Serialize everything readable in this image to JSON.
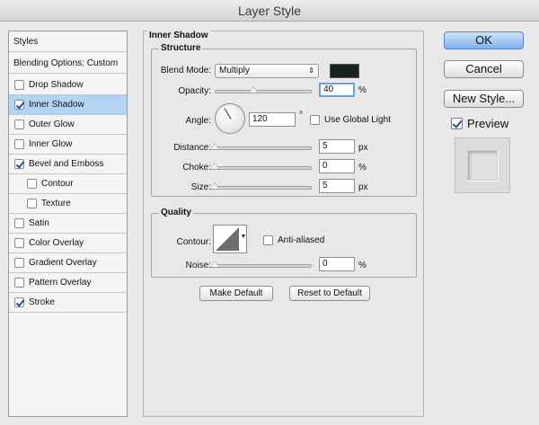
{
  "window": {
    "title": "Layer Style"
  },
  "styles_panel": {
    "header": "Styles",
    "blending_options": "Blending Options: Custom",
    "items": [
      {
        "label": "Drop Shadow",
        "checked": false,
        "selected": false
      },
      {
        "label": "Inner Shadow",
        "checked": true,
        "selected": true
      },
      {
        "label": "Outer Glow",
        "checked": false,
        "selected": false
      },
      {
        "label": "Inner Glow",
        "checked": false,
        "selected": false
      },
      {
        "label": "Bevel and Emboss",
        "checked": true,
        "selected": false
      },
      {
        "label": "Contour",
        "checked": false,
        "selected": false,
        "sub": true
      },
      {
        "label": "Texture",
        "checked": false,
        "selected": false,
        "sub": true
      },
      {
        "label": "Satin",
        "checked": false,
        "selected": false
      },
      {
        "label": "Color Overlay",
        "checked": false,
        "selected": false
      },
      {
        "label": "Gradient Overlay",
        "checked": false,
        "selected": false
      },
      {
        "label": "Pattern Overlay",
        "checked": false,
        "selected": false
      },
      {
        "label": "Stroke",
        "checked": true,
        "selected": false
      }
    ]
  },
  "inner_shadow": {
    "title": "Inner Shadow",
    "structure": {
      "title": "Structure",
      "blend_mode_label": "Blend Mode:",
      "blend_mode_value": "Multiply",
      "blend_color": "#1a2222",
      "opacity_label": "Opacity:",
      "opacity_value": "40",
      "opacity_unit": "%",
      "opacity_level": 0.4,
      "angle_label": "Angle:",
      "angle_value": "120",
      "angle_unit": "°",
      "angle_degrees": 120,
      "global_light_label": "Use Global Light",
      "global_light_checked": false,
      "distance_label": "Distance:",
      "distance_value": "5",
      "distance_unit": "px",
      "distance_level": 0.0,
      "choke_label": "Choke:",
      "choke_value": "0",
      "choke_unit": "%",
      "choke_level": 0.0,
      "size_label": "Size:",
      "size_value": "5",
      "size_unit": "px",
      "size_level": 0.0
    },
    "quality": {
      "title": "Quality",
      "contour_label": "Contour:",
      "anti_aliased_label": "Anti-aliased",
      "anti_aliased_checked": false,
      "noise_label": "Noise:",
      "noise_value": "0",
      "noise_unit": "%",
      "noise_level": 0.0
    },
    "make_default_label": "Make Default",
    "reset_default_label": "Reset to Default"
  },
  "actions": {
    "ok_label": "OK",
    "cancel_label": "Cancel",
    "new_style_label": "New Style...",
    "preview_label": "Preview",
    "preview_checked": true
  }
}
